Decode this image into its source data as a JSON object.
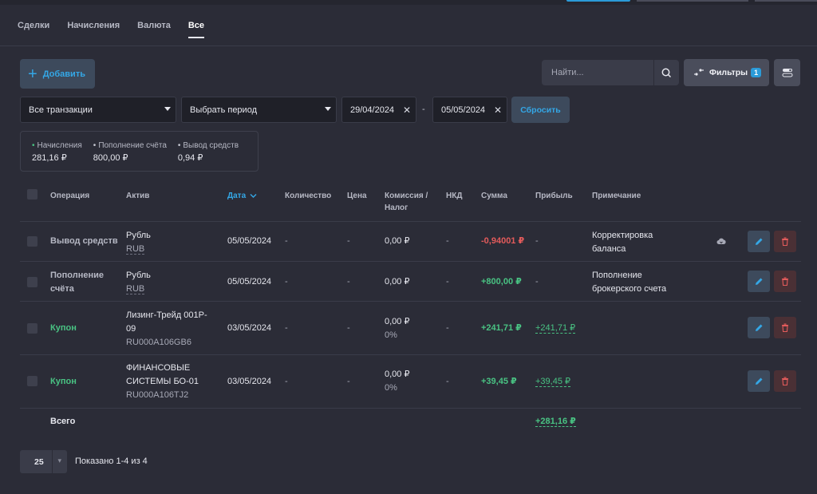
{
  "tabs": [
    {
      "label": "Сделки"
    },
    {
      "label": "Начисления"
    },
    {
      "label": "Валюта"
    },
    {
      "label": "Все"
    }
  ],
  "toolbar": {
    "add_label": "Добавить",
    "search_placeholder": "Найти...",
    "filters_label": "Фильтры",
    "filters_count": "1",
    "reset_label": "Сбросить"
  },
  "filters": {
    "type_value": "Все транзакции",
    "period_value": "Выбрать период",
    "date_from": "29/04/2024",
    "date_to": "05/05/2024",
    "dash": "-"
  },
  "summary": [
    {
      "label": "Начисления",
      "value": "281,16 ₽",
      "color": "#49c383"
    },
    {
      "label": "Пополнение счёта",
      "value": "800,00 ₽",
      "color": "#c6c8d2"
    },
    {
      "label": "Вывод средств",
      "value": "0,94 ₽",
      "color": "#c6c8d2"
    }
  ],
  "table": {
    "headers": {
      "operation": "Операция",
      "asset": "Актив",
      "date": "Дата",
      "quantity": "Количество",
      "price": "Цена",
      "fee_line1": "Комиссия /",
      "fee_line2": "Налог",
      "nkd": "НКД",
      "amount": "Сумма",
      "profit": "Прибыль",
      "note": "Примечание"
    },
    "rows": [
      {
        "op1": "Вывод средств",
        "op2": "",
        "asset1": "Рубль",
        "asset2": "",
        "asset_code": "RUB",
        "date": "05/05/2024",
        "qty": "-",
        "price": "-",
        "fee": "0,00 ₽",
        "fee2": "",
        "nkd": "-",
        "amount": "-0,94001 ₽",
        "profit": "-",
        "note1": "Корректировка",
        "note2": "баланса"
      },
      {
        "op1": "Пополнение",
        "op2": "счёта",
        "asset1": "Рубль",
        "asset2": "",
        "asset_code": "RUB",
        "date": "05/05/2024",
        "qty": "-",
        "price": "-",
        "fee": "0,00 ₽",
        "fee2": "",
        "nkd": "-",
        "amount": "+800,00 ₽",
        "profit": "-",
        "note1": "Пополнение",
        "note2": "брокерского счета"
      },
      {
        "op1": "Купон",
        "op2": "",
        "asset1": "Лизинг-Трейд 001P-",
        "asset2": "09",
        "asset_code": "RU000A106GB6",
        "date": "03/05/2024",
        "qty": "-",
        "price": "-",
        "fee": "0,00 ₽",
        "fee2": "0%",
        "nkd": "-",
        "amount": "+241,71 ₽",
        "profit": "+241,71 ₽",
        "note1": "",
        "note2": ""
      },
      {
        "op1": "Купон",
        "op2": "",
        "asset1": "ФИНАНСОВЫЕ",
        "asset2": "СИСТЕМЫ БО-01",
        "asset_code": "RU000A106TJ2",
        "date": "03/05/2024",
        "qty": "-",
        "price": "-",
        "fee": "0,00 ₽",
        "fee2": "0%",
        "nkd": "-",
        "amount": "+39,45 ₽",
        "profit": "+39,45 ₽",
        "note1": "",
        "note2": ""
      }
    ],
    "total_label": "Всего",
    "total_profit": "+281,16 ₽"
  },
  "pagination": {
    "page_size": "25",
    "shown_text": "Показано 1-4 из 4"
  },
  "colors": {
    "accent": "#2b9bd8",
    "positive": "#49c383",
    "negative": "#e35b5b",
    "background": "#2b2c37"
  }
}
